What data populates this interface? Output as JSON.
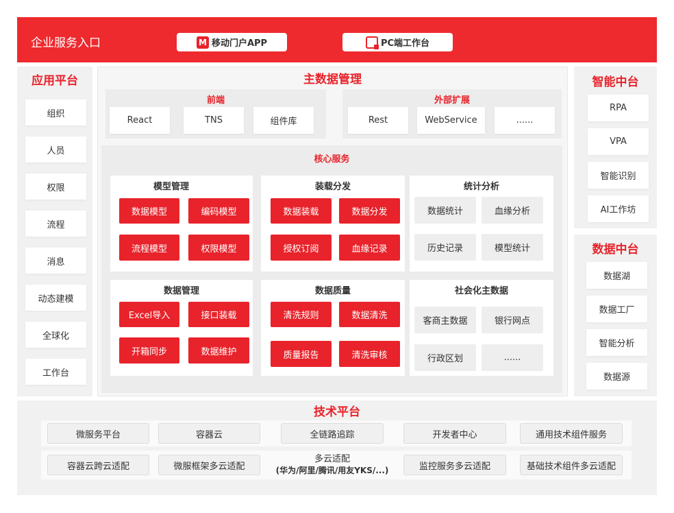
{
  "header": {
    "title": "企业服务入口",
    "mobile_button": "移动门户APP",
    "mobile_icon_letter": "M",
    "pc_button": "PC端工作台"
  },
  "app_platform": {
    "title": "应用平台",
    "items": [
      "组织",
      "人员",
      "权限",
      "流程",
      "消息",
      "动态建模",
      "全球化",
      "工作台"
    ]
  },
  "mdm": {
    "title": "主数据管理",
    "frontend": {
      "title": "前端",
      "items": [
        "React",
        "TNS",
        "组件库"
      ]
    },
    "external": {
      "title": "外部扩展",
      "items": [
        "Rest",
        "WebService",
        "......"
      ]
    },
    "core": {
      "title": "核心服务",
      "model_mgmt": {
        "title": "模型管理",
        "items": [
          "数据模型",
          "编码模型",
          "流程模型",
          "权限模型"
        ]
      },
      "load_dist": {
        "title": "装载分发",
        "items": [
          "数据装载",
          "数据分发",
          "授权订阅",
          "血缘记录"
        ]
      },
      "stats": {
        "title": "统计分析",
        "items": [
          "数据统计",
          "血缘分析",
          "历史记录",
          "模型统计"
        ]
      },
      "data_mgmt": {
        "title": "数据管理",
        "items": [
          "Excel导入",
          "接口装载",
          "开箱同步",
          "数据维护"
        ]
      },
      "quality": {
        "title": "数据质量",
        "items": [
          "清洗规则",
          "数据清洗",
          "质量报告",
          "清洗审核"
        ]
      },
      "social": {
        "title": "社会化主数据",
        "items": [
          "客商主数据",
          "银行网点",
          "行政区划",
          "......"
        ]
      }
    }
  },
  "smart_center": {
    "title": "智能中台",
    "items": [
      "RPA",
      "VPA",
      "智能识别",
      "AI工作坊"
    ]
  },
  "data_center": {
    "title": "数据中台",
    "items": [
      "数据湖",
      "数据工厂",
      "智能分析",
      "数据源"
    ]
  },
  "tech_platform": {
    "title": "技术平台",
    "row1": [
      "微服务平台",
      "容器云",
      "全链路追踪",
      "开发者中心",
      "通用技术组件服务"
    ],
    "row2": [
      "容器云跨云适配",
      "微服框架多云适配",
      "多云适配",
      "监控服务多云适配",
      "基础技术组件多云适配"
    ],
    "row2_sub": "(华为/阿里/腾讯/用友YKS/...)"
  },
  "colors": {
    "accent": "#e8232b",
    "panel": "#f1f1f1"
  }
}
